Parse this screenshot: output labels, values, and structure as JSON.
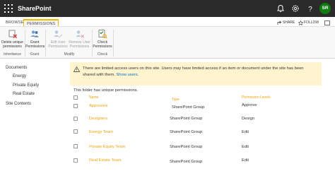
{
  "suite_bar": {
    "app_name": "SharePoint",
    "avatar_initials": "SR",
    "icons": [
      "waffle-icon",
      "bell-icon",
      "gear-icon",
      "help-icon"
    ]
  },
  "tabs": {
    "browse": "BROWSE",
    "permissions": "PERMISSIONS",
    "share": "SHARE",
    "follow": "FOLLOW"
  },
  "ribbon": {
    "inheritance": {
      "label": "Inheritance",
      "delete_unique_line1": "Delete unique",
      "delete_unique_line2": "permissions"
    },
    "grant": {
      "label": "Grant",
      "grant_line1": "Grant",
      "grant_line2": "Permissions"
    },
    "modify": {
      "label": "Modify",
      "edit_line1": "Edit User",
      "edit_line2": "Permissions",
      "remove_line1": "Remove User",
      "remove_line2": "Permissions"
    },
    "check": {
      "label": "Check",
      "check_line1": "Check",
      "check_line2": "Permissions"
    }
  },
  "left_nav": {
    "documents": "Documents",
    "energy": "Energy",
    "private_equity": "Private Equity",
    "real_estate": "Real Estate",
    "site_contents": "Site Contents"
  },
  "warning": {
    "line1": "There are limited access users on this site. Users may have limited access if an item or document under the site has been",
    "line2_prefix": "shared with them.",
    "show_users": "Show users",
    "line2_suffix": "."
  },
  "unique_notice": "This folder has unique permissions.",
  "table": {
    "headers": {
      "name": "Name",
      "type": "Type",
      "levels": "Permission Levels"
    },
    "rows": [
      {
        "name": "Approvers",
        "type": "SharePoint Group",
        "level": "Approve"
      },
      {
        "name": "Designers",
        "type": "SharePoint Group",
        "level": "Design"
      },
      {
        "name": "Energy Team",
        "type": "SharePoint Group",
        "level": "Edit"
      },
      {
        "name": "Private Equity Team",
        "type": "SharePoint Group",
        "level": "Edit"
      },
      {
        "name": "Real Estate Team",
        "type": "SharePoint Group",
        "level": "Edit"
      }
    ]
  },
  "colors": {
    "suite_bar": "#2a2a2a",
    "accent": "#f0a30a",
    "link": "#0072c6",
    "warning_bg": "#fff4ce",
    "avatar": "#107c10"
  }
}
